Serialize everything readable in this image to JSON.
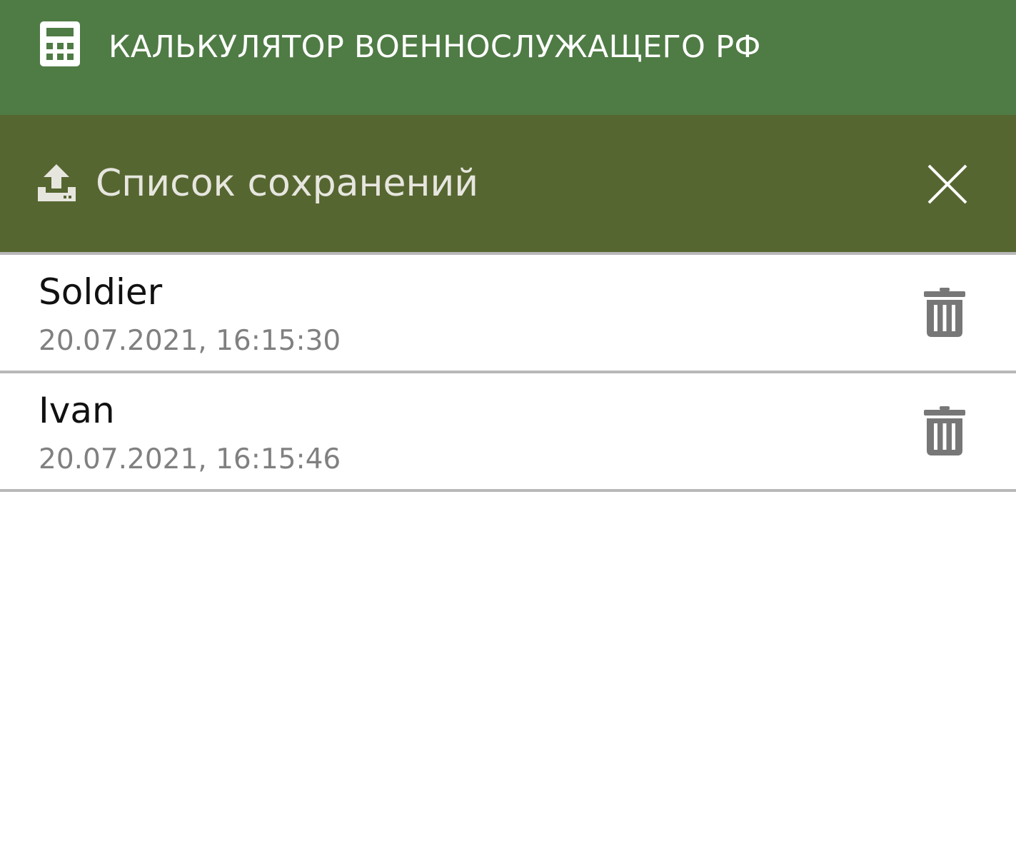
{
  "app_bar": {
    "icon": "calculator-icon",
    "title": "КАЛЬКУЛЯТОР ВОЕННОСЛУЖАЩЕГО РФ",
    "background": "#4f7b45"
  },
  "panel": {
    "icon": "upload-icon",
    "title": "Список сохранений",
    "close_icon": "close-icon",
    "background": "#566631"
  },
  "saves": [
    {
      "name": "Soldier",
      "date": "20.07.2021, 16:15:30",
      "delete_icon": "trash-icon"
    },
    {
      "name": "Ivan",
      "date": "20.07.2021, 16:15:46",
      "delete_icon": "trash-icon"
    }
  ],
  "colors": {
    "item_name": "#111111",
    "item_date": "#808080",
    "divider": "#b8b8b8",
    "trash": "#777777"
  }
}
